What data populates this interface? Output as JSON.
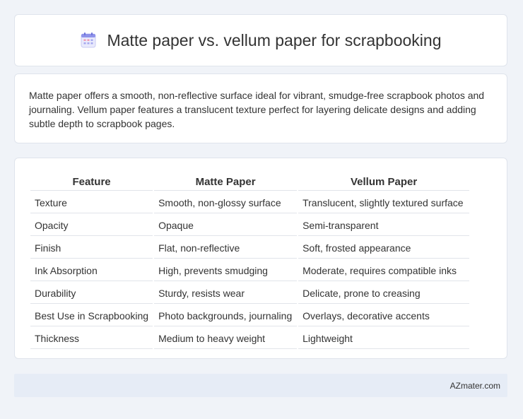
{
  "header": {
    "title": "Matte paper vs. vellum paper for scrapbooking",
    "icon": "calendar-icon"
  },
  "description": "Matte paper offers a smooth, non-reflective surface ideal for vibrant, smudge-free scrapbook photos and journaling. Vellum paper features a translucent texture perfect for layering delicate designs and adding subtle depth to scrapbook pages.",
  "table": {
    "headers": [
      "Feature",
      "Matte Paper",
      "Vellum Paper"
    ],
    "rows": [
      [
        "Texture",
        "Smooth, non-glossy surface",
        "Translucent, slightly textured surface"
      ],
      [
        "Opacity",
        "Opaque",
        "Semi-transparent"
      ],
      [
        "Finish",
        "Flat, non-reflective",
        "Soft, frosted appearance"
      ],
      [
        "Ink Absorption",
        "High, prevents smudging",
        "Moderate, requires compatible inks"
      ],
      [
        "Durability",
        "Sturdy, resists wear",
        "Delicate, prone to creasing"
      ],
      [
        "Best Use in Scrapbooking",
        "Photo backgrounds, journaling",
        "Overlays, decorative accents"
      ],
      [
        "Thickness",
        "Medium to heavy weight",
        "Lightweight"
      ]
    ]
  },
  "footer": {
    "text": "AZmater.com"
  },
  "colors": {
    "background": "#f0f3f8",
    "card": "#ffffff",
    "footer_bg": "#e6ecf6",
    "icon_accent": "#7b7fe0"
  }
}
